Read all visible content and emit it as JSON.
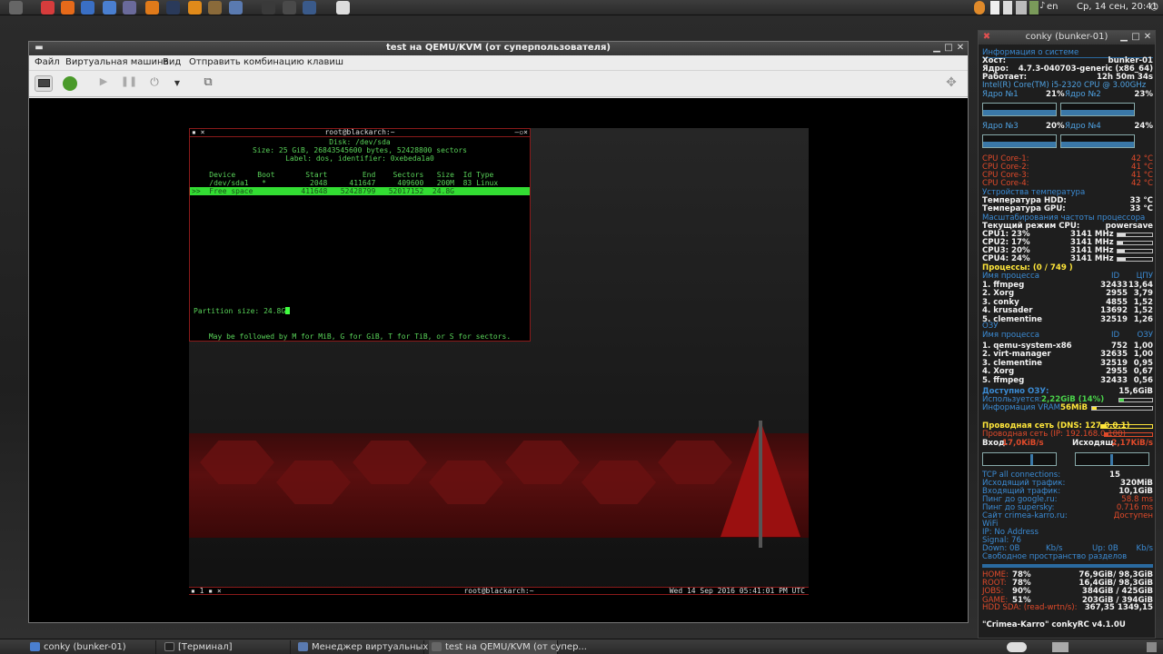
{
  "top_panel": {
    "launchers": [
      {
        "name": "system-menu-icon",
        "color": "#666"
      },
      {
        "name": "vivaldi-icon",
        "color": "#d63c3c"
      },
      {
        "name": "firefox-icon",
        "color": "#e66a1a"
      },
      {
        "name": "thunderbird-icon",
        "color": "#3a6fc4"
      },
      {
        "name": "files-icon",
        "color": "#4a7fd0"
      },
      {
        "name": "screenshot-icon",
        "color": "#6a6a9a"
      },
      {
        "name": "blender-icon",
        "color": "#e07a1a"
      },
      {
        "name": "steam-icon",
        "color": "#2a3a5a"
      },
      {
        "name": "rss-icon",
        "color": "#e08a1a"
      },
      {
        "name": "archive-icon",
        "color": "#8a6a3a"
      },
      {
        "name": "virt-manager-icon",
        "color": "#5a7ab0"
      },
      {
        "name": "terminal-icon",
        "color": "#3a3a3a"
      },
      {
        "name": "network-tool-icon",
        "color": "#4a4a4a"
      },
      {
        "name": "settings-icon",
        "color": "#3a5a8a"
      },
      {
        "name": "text-editor-icon",
        "color": "#ddd"
      }
    ],
    "language": "en",
    "clock": "Ср, 14 сен, 20:41"
  },
  "vm_window": {
    "title": "test на QEMU/KVM (от суперпользователя)",
    "menu": [
      "Файл",
      "Виртуальная машина",
      "Вид",
      "Отправить комбинацию клавиш"
    ],
    "toolbar_buttons": [
      "console-view-button",
      "details-view-button",
      "run-button",
      "pause-button",
      "power-button",
      "power-menu-button",
      "snapshot-button"
    ]
  },
  "terminal": {
    "title": "root@blackarch:~",
    "disk_line": "Disk: /dev/sda",
    "size_line": "Size: 25 GiB, 26843545600 bytes, 52428800 sectors",
    "label_line": "Label: dos, identifier: 0xebeda1a0",
    "header": "    Device     Boot       Start        End    Sectors   Size  Id Type",
    "row1": "    /dev/sda1   *          2048     411647     409600   200M  83 Linux",
    "row_selected": ">>  Free space           411648   52428799   52017152  24.8G",
    "prompt_label": "Partition size: ",
    "prompt_value": "24.8G",
    "hint": "May be followed by M for MiB, G for GiB, T for TiB, or S for sectors."
  },
  "guest_statusbar": {
    "left": "▪ 1 ▪ ×",
    "center": "root@blackarch:~",
    "right": "Wed 14 Sep 2016 05:41:01 PM UTC"
  },
  "conky": {
    "title": "conky (bunker-01)",
    "sys_header": "Информация о системе",
    "host_label": "Хост:",
    "host": "bunker-01",
    "kernel_label": "Ядро:",
    "kernel": "4.7.3-040703-generic (x86_64)",
    "uptime_label": "Работает:",
    "uptime": "12h 50m 34s",
    "cpu_model": "Intel(R) Core(TM) i5-2320 CPU @ 3.00GHz",
    "cores": [
      {
        "label": "Ядро №1",
        "value": "21%"
      },
      {
        "label": "Ядро №2",
        "value": "23%"
      },
      {
        "label": "Ядро №3",
        "value": "20%"
      },
      {
        "label": "Ядро №4",
        "value": "24%"
      }
    ],
    "core_temps": [
      {
        "label": "CPU Core-1:",
        "value": "42 °C"
      },
      {
        "label": "CPU Core-2:",
        "value": "41 °C"
      },
      {
        "label": "CPU Core-3:",
        "value": "41 °C"
      },
      {
        "label": "CPU Core-4:",
        "value": "42 °C"
      }
    ],
    "temp_header": "Устройства температура",
    "hdd_temp_label": "Температура HDD:",
    "hdd_temp": "33 °C",
    "gpu_temp_label": "Температура GPU:",
    "gpu_temp": "33 °C",
    "freq_header": "Масштабирования частоты процессора",
    "governor_label": "Текущий режим CPU:",
    "governor": "powersave",
    "cpu_freqs": [
      {
        "label": "CPU1: 23%",
        "mhz": "3141 MHz",
        "fill": 0.23
      },
      {
        "label": "CPU2: 17%",
        "mhz": "3141 MHz",
        "fill": 0.17
      },
      {
        "label": "CPU3: 20%",
        "mhz": "3141 MHz",
        "fill": 0.2
      },
      {
        "label": "CPU4: 24%",
        "mhz": "3141 MHz",
        "fill": 0.24
      }
    ],
    "procs_label": "Процессы: (0  / 749 )",
    "cpu_proc_header": "Имя процесса",
    "id_col": "ID",
    "cpu_col": "ЦПУ",
    "cpu_procs": [
      {
        "name": "1. ffmpeg",
        "id": "32433",
        "val": "13,64"
      },
      {
        "name": "2. Xorg",
        "id": "2955",
        "val": "3,79"
      },
      {
        "name": "3. conky",
        "id": "4855",
        "val": "1,52"
      },
      {
        "name": "4. krusader",
        "id": "13692",
        "val": "1,52"
      },
      {
        "name": "5. clementine",
        "id": "32519",
        "val": "1,26"
      }
    ],
    "ram_header": "ОЗУ",
    "mem_proc_header": "Имя процесса",
    "mem_col": "ОЗУ",
    "mem_procs": [
      {
        "name": "1. qemu-system-x86",
        "id": "752",
        "val": "1,00"
      },
      {
        "name": "2. virt-manager",
        "id": "32635",
        "val": "1,00"
      },
      {
        "name": "3. clementine",
        "id": "32519",
        "val": "0,95"
      },
      {
        "name": "4. Xorg",
        "id": "2955",
        "val": "0,67"
      },
      {
        "name": "5. ffmpeg",
        "id": "32433",
        "val": "0,56"
      }
    ],
    "ram_avail_label": "Доступно ОЗУ:",
    "ram_avail": "15,6GiB",
    "ram_used_label": "Используется:",
    "ram_used": "2,22GiB (14%)",
    "ram_used_fill": 0.14,
    "vram_label": "Информация VRAM:",
    "vram": "56MiB",
    "wired_dns": "Проводная сеть (DNS: 127.0.0.1)",
    "wired_ip": "Проводная сеть (IP: 192.168.0.100)",
    "in_label": "Вход.",
    "in_val": "17,0KiB/s",
    "out_label": "Исходящ.",
    "out_val": "2,17KiB/s",
    "tcp_label": "TCP all connections:",
    "tcp": "15",
    "out_traffic_label": "Исходящий  трафик:",
    "out_traffic": "320MiB",
    "in_traffic_label": "Входящий трафик:",
    "in_traffic": "10,1GiB",
    "ping_google_label": "Пинг до google.ru:",
    "ping_google": "58.8 ms",
    "ping_supersky_label": "Пинг до supersky:",
    "ping_supersky": "0.716 ms",
    "site_label": "Сайт crimea-karro.ru:",
    "site": "Доступен",
    "wifi_header": "WiFi",
    "wifi_ip": "IP: No Address",
    "wifi_signal": "Signal: 76",
    "wifi_down": "Down: 0B",
    "wifi_down_unit": "Kb/s",
    "wifi_up": "Up: 0B",
    "wifi_up_unit": "Kb/s",
    "disk_header": "Свободное пространство разделов",
    "disks": [
      {
        "label": "HOME:",
        "pct": "78%",
        "val": "76,9GiB/ 98,3GiB"
      },
      {
        "label": "ROOT:",
        "pct": "78%",
        "val": "16,4GiB/ 98,3GiB"
      },
      {
        "label": "JOBS:",
        "pct": "90%",
        "val": "384GiB / 425GiB"
      },
      {
        "label": "GAME:",
        "pct": "51%",
        "val": "203GiB / 394GiB"
      }
    ],
    "hdd_rw_label": "HDD SDA: (read-wrtn/s):",
    "hdd_rw": "367,35 1349,15",
    "footer": "\"Crimea-Karro\" conkyRC v4.1.0U"
  },
  "taskbar": {
    "tasks": [
      {
        "label": "conky (bunker-01)"
      },
      {
        "label": "[Терминал]"
      },
      {
        "label": "Менеджер виртуальных..."
      },
      {
        "label": "test на QEMU/KVM (от супер..."
      }
    ]
  },
  "colors": {
    "conky_section": "#3b8bd4",
    "conky_red": "#e04a2a",
    "conky_yellow": "#ffe63a",
    "terminal_green": "#59d359",
    "terminal_selection": "#33dd33"
  }
}
